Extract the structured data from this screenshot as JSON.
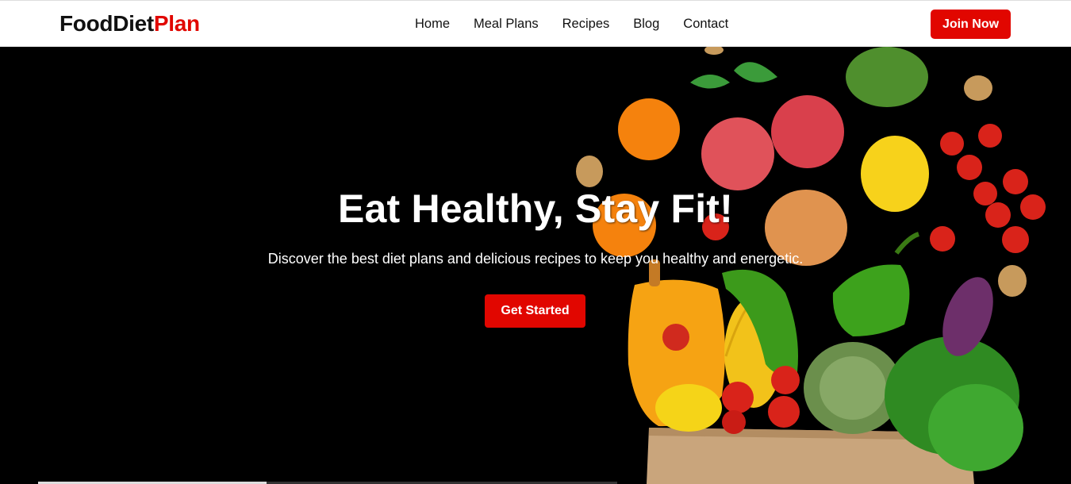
{
  "brand": {
    "name_main": "FoodDiet",
    "name_accent": "Plan",
    "accent_color": "#e10600"
  },
  "nav": {
    "items": [
      {
        "label": "Home"
      },
      {
        "label": "Meal Plans"
      },
      {
        "label": "Recipes"
      },
      {
        "label": "Blog"
      },
      {
        "label": "Contact"
      }
    ],
    "join_label": "Join Now"
  },
  "hero": {
    "title": "Eat Healthy, Stay Fit!",
    "subtitle": "Discover the best diet plans and delicious recipes to keep you healthy and energetic.",
    "cta_label": "Get Started",
    "image_icon": "vegetables-grocery-bag-illustration"
  }
}
